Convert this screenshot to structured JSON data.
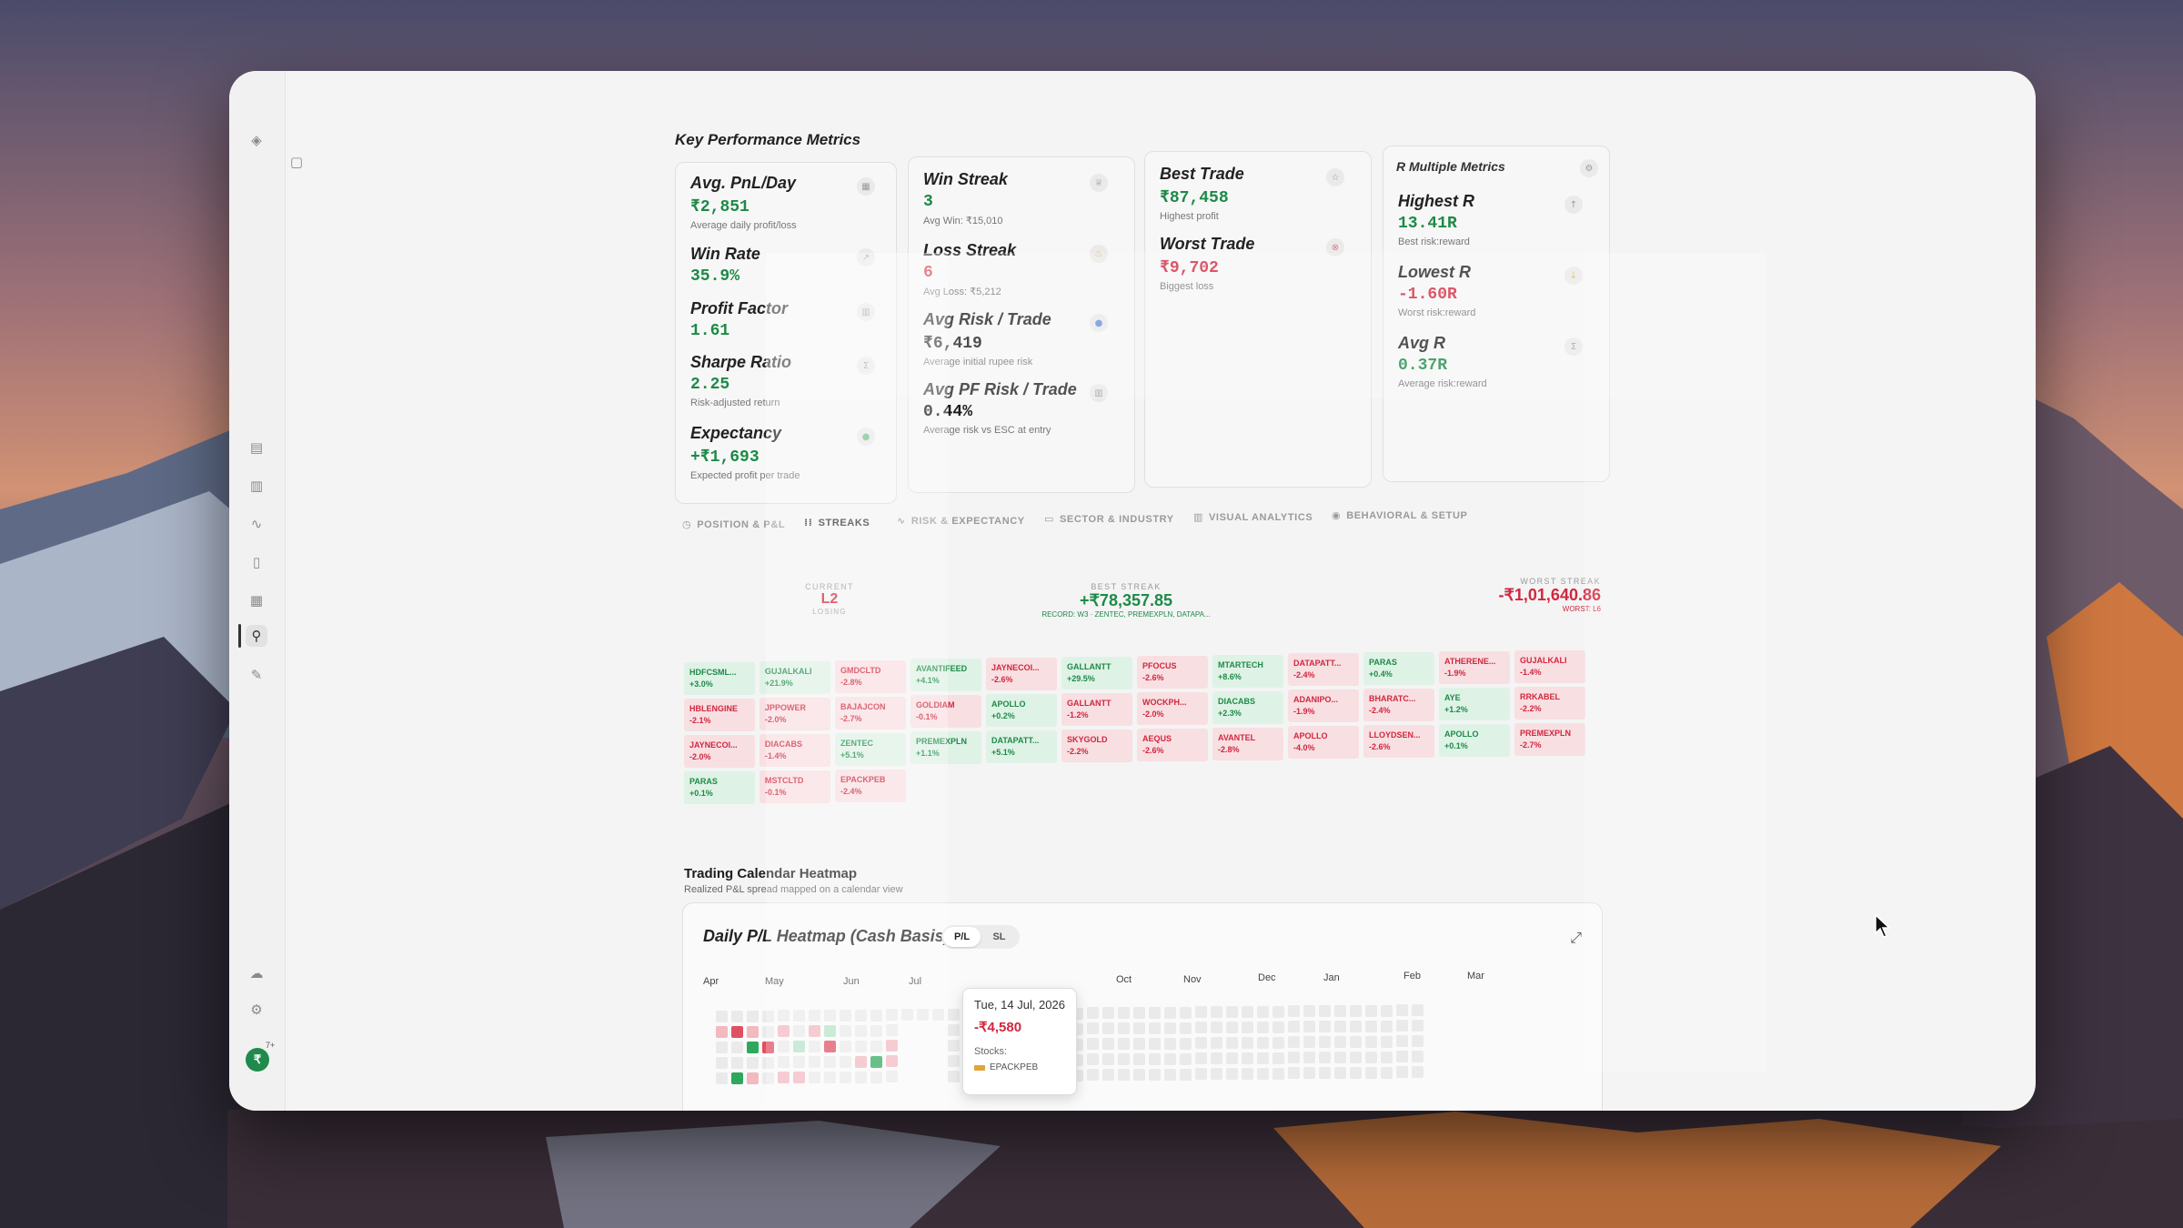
{
  "colors": {
    "positive": "#1d8a47",
    "negative": "#d1273f",
    "win_cell_bg": "#dff2e6",
    "loss_cell_bg": "#f8dfe2"
  },
  "section_title": "Key Performance Metrics",
  "cards": {
    "card1": {
      "metrics": [
        {
          "label": "Avg. PnL/Day",
          "value": "₹2,851",
          "sub": "Average daily profit/loss",
          "icon": "calendar-icon"
        },
        {
          "label": "Win Rate",
          "value": "35.9%",
          "sub": "",
          "icon": "trend-icon"
        },
        {
          "label": "Profit Factor",
          "value": "1.61",
          "sub": "",
          "icon": "bar-chart-icon"
        },
        {
          "label": "Sharpe Ratio",
          "value": "2.25",
          "sub": "Risk-adjusted return",
          "icon": "sigma-icon"
        },
        {
          "label": "Expectancy",
          "value": "+₹1,693",
          "sub": "Expected profit per trade",
          "icon": "dot-icon"
        }
      ]
    },
    "card2": {
      "metrics": [
        {
          "label": "Win Streak",
          "value": "3",
          "sub": "Avg Win: ₹15,010",
          "icon": "trophy-icon"
        },
        {
          "label": "Loss Streak",
          "value": "6",
          "sub": "Avg Loss: ₹5,212",
          "icon": "flame-icon"
        },
        {
          "label": "Avg Risk / Trade",
          "value": "₹6,419",
          "sub": "Average initial rupee risk",
          "icon": "shield-icon"
        },
        {
          "label": "Avg PF Risk / Trade",
          "value": "0.44%",
          "sub": "Average risk vs ESC at entry",
          "icon": "bar-chart-icon"
        }
      ]
    },
    "card3": {
      "metrics": [
        {
          "label": "Best Trade",
          "value": "₹87,458",
          "sub": "Highest profit",
          "icon": "star-icon"
        },
        {
          "label": "Worst Trade",
          "value": "₹9,702",
          "sub": "Biggest loss",
          "icon": "x-circle-icon"
        }
      ]
    },
    "card4": {
      "title": "R Multiple Metrics",
      "metrics": [
        {
          "label": "Highest R",
          "value": "13.41R",
          "sub": "Best risk:reward",
          "icon": "arrow-up-icon"
        },
        {
          "label": "Lowest R",
          "value": "-1.60R",
          "sub": "Worst risk:reward",
          "icon": "arrow-down-icon"
        },
        {
          "label": "Avg R",
          "value": "0.37R",
          "sub": "Average risk:reward",
          "icon": "sigma-icon"
        }
      ]
    }
  },
  "tabs": [
    {
      "label": "POSITION & P&L",
      "icon": "clock-icon"
    },
    {
      "label": "STREAKS",
      "icon": "grid-icon"
    },
    {
      "label": "RISK & EXPECTANCY",
      "icon": "pulse-icon"
    },
    {
      "label": "SECTOR & INDUSTRY",
      "icon": "folder-icon"
    },
    {
      "label": "VISUAL ANALYTICS",
      "icon": "chart-icon"
    },
    {
      "label": "BEHAVIORAL & SETUP",
      "icon": "brain-icon"
    }
  ],
  "streaks": {
    "current": {
      "caption": "CURRENT",
      "value": "L2",
      "note": "LOSING"
    },
    "best": {
      "caption": "BEST STREAK",
      "value": "+₹78,357.85",
      "note": "RECORD: W3 · ZENTEC, PREMEXPLN, DATAPA..."
    },
    "worst": {
      "caption": "WORST STREAK",
      "value": "-₹1,01,640.86",
      "note": "WORST: L6"
    }
  },
  "trades": [
    [
      "HDFCSML...",
      "+3.0%",
      "win"
    ],
    [
      "GUJALKALI",
      "+21.9%",
      "win"
    ],
    [
      "GMDCLTD",
      "-2.8%",
      "loss"
    ],
    [
      "AVANTIFEED",
      "+4.1%",
      "win"
    ],
    [
      "JAYNECOI...",
      "-2.6%",
      "loss"
    ],
    [
      "GALLANTT",
      "+29.5%",
      "win"
    ],
    [
      "PFOCUS",
      "-2.6%",
      "loss"
    ],
    [
      "MTARTECH",
      "+8.6%",
      "win"
    ],
    [
      "DATAPATT...",
      "-2.4%",
      "loss"
    ],
    [
      "PARAS",
      "+0.4%",
      "win"
    ],
    [
      "ATHERENE...",
      "-1.9%",
      "loss"
    ],
    [
      "GUJALKALI",
      "-1.4%",
      "loss"
    ],
    [
      "HBLENGINE",
      "-2.1%",
      "loss"
    ],
    [
      "JPPOWER",
      "-2.0%",
      "loss"
    ],
    [
      "BAJAJCON",
      "-2.7%",
      "loss"
    ],
    [
      "GOLDIAM",
      "-0.1%",
      "loss"
    ],
    [
      "APOLLO",
      "+0.2%",
      "win"
    ],
    [
      "GALLANTT",
      "-1.2%",
      "loss"
    ],
    [
      "WOCKPH...",
      "-2.0%",
      "loss"
    ],
    [
      "DIACABS",
      "+2.3%",
      "win"
    ],
    [
      "ADANIPO...",
      "-1.9%",
      "loss"
    ],
    [
      "BHARATC...",
      "-2.4%",
      "loss"
    ],
    [
      "AYE",
      "+1.2%",
      "win"
    ],
    [
      "RRKABEL",
      "-2.2%",
      "loss"
    ],
    [
      "JAYNECOI...",
      "-2.0%",
      "loss"
    ],
    [
      "DIACABS",
      "-1.4%",
      "loss"
    ],
    [
      "ZENTEC",
      "+5.1%",
      "win"
    ],
    [
      "PREMEXPLN",
      "+1.1%",
      "win"
    ],
    [
      "DATAPATT...",
      "+5.1%",
      "win"
    ],
    [
      "SKYGOLD",
      "-2.2%",
      "loss"
    ],
    [
      "AEQUS",
      "-2.6%",
      "loss"
    ],
    [
      "AVANTEL",
      "-2.8%",
      "loss"
    ],
    [
      "APOLLO",
      "-4.0%",
      "loss"
    ],
    [
      "LLOYDSEN...",
      "-2.6%",
      "loss"
    ],
    [
      "APOLLO",
      "+0.1%",
      "win"
    ],
    [
      "PREMEXPLN",
      "-2.7%",
      "loss"
    ],
    [
      "PARAS",
      "+0.1%",
      "win"
    ],
    [
      "MSTCLTD",
      "-0.1%",
      "loss"
    ],
    [
      "EPACKPEB",
      "-2.4%",
      "loss"
    ]
  ],
  "calendar": {
    "title": "Trading Calendar Heatmap",
    "subtitle": "Realized P&L spread mapped on a calendar view",
    "heatmap_title": "Daily P/L Heatmap (Cash Basis)",
    "toggle": [
      "P/L",
      "SL"
    ],
    "months": [
      "Apr",
      "May",
      "Jun",
      "Jul",
      "Oct",
      "Nov",
      "Dec",
      "Jan",
      "Feb",
      "Mar"
    ],
    "tooltip": {
      "date": "Tue, 14 Jul, 2026",
      "value": "-₹4,580",
      "stocks_label": "Stocks:",
      "stock": "EPACKPEB"
    }
  },
  "sidebar": {
    "icons": [
      "logo-icon",
      "collapse-icon",
      "journal-icon",
      "bar-chart-icon",
      "pulse-icon",
      "notes-icon",
      "calendar-icon",
      "analytics-icon",
      "pen-icon",
      "cloud-icon",
      "settings-icon"
    ],
    "avatar": "₹",
    "avatar_badge": "7+"
  }
}
